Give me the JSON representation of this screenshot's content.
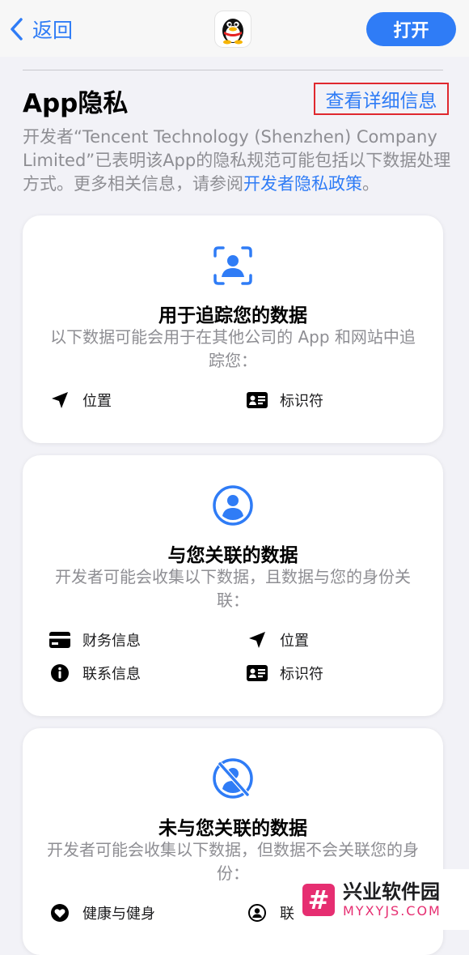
{
  "nav": {
    "back_label": "返回",
    "open_label": "打开"
  },
  "privacy": {
    "title": "App隐私",
    "details_link": "查看详细信息",
    "desc_prefix": "开发者“Tencent Technology (Shenzhen) Company Limited”已表明该App的隐私规范可能包括以下数据处理方式。更多相关信息，请参阅",
    "desc_link": "开发者隐私政策",
    "desc_suffix": "。"
  },
  "cards": [
    {
      "title": "用于追踪您的数据",
      "subtitle": "以下数据可能会用于在其他公司的 App 和网站中追踪您：",
      "items": [
        "位置",
        "标识符"
      ]
    },
    {
      "title": "与您关联的数据",
      "subtitle": "开发者可能会收集以下数据，且数据与您的身份关联：",
      "items": [
        "财务信息",
        "位置",
        "联系信息",
        "标识符"
      ]
    },
    {
      "title": "未与您关联的数据",
      "subtitle": "开发者可能会收集以下数据，但数据不会关联您的身份：",
      "items": [
        "健康与健身",
        "联"
      ]
    }
  ],
  "watermark": {
    "symbol": "#",
    "text_cn": "兴业软件园",
    "text_en": "MYXYJS.COM"
  },
  "colors": {
    "accent": "#2f7cf6",
    "highlight_border": "#e0282e",
    "secondary_text": "#8e8e93",
    "background": "#f2f2f7"
  },
  "icons": {
    "card_tracking": "person-viewfinder-icon",
    "card_linked": "person-circle-icon",
    "card_not_linked": "person-slash-icon",
    "location": "location-arrow-icon",
    "identifiers": "id-card-icon",
    "financial": "credit-card-icon",
    "contact": "info-circle-icon",
    "health": "heart-circle-icon",
    "user": "person-circle-small-icon"
  }
}
